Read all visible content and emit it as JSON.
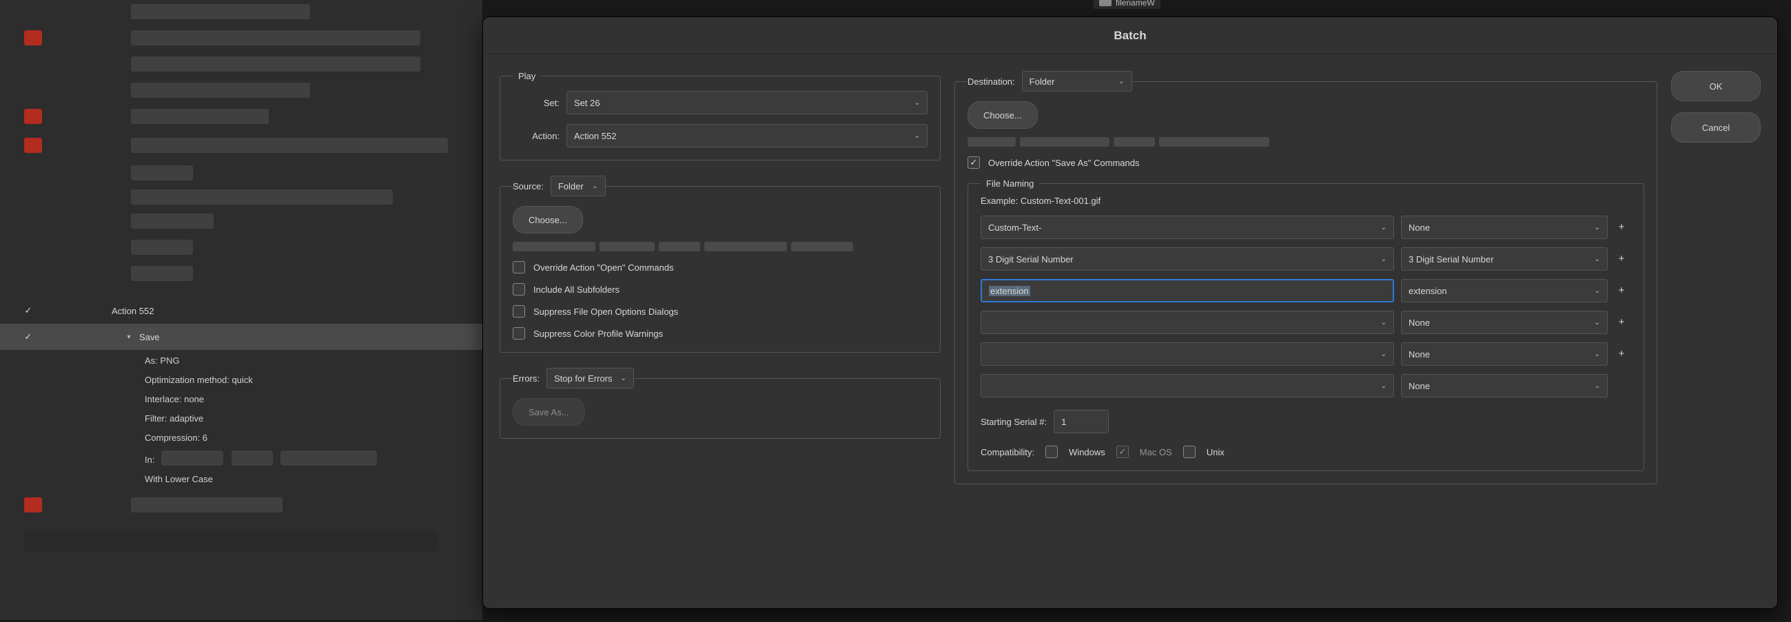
{
  "top_tab": {
    "label": "filenameW"
  },
  "actions_panel": {
    "action_row": {
      "label": "Action 552"
    },
    "save_row": {
      "label": "Save"
    },
    "details": {
      "as": "As: PNG",
      "opt": "Optimization method: quick",
      "interlace": "Interlace: none",
      "filter": "Filter: adaptive",
      "compression": "Compression: 6",
      "in": "In:",
      "withlower": "With Lower Case"
    }
  },
  "dialog": {
    "title": "Batch",
    "ok": "OK",
    "cancel": "Cancel",
    "play": {
      "legend": "Play",
      "set_label": "Set:",
      "set_value": "Set 26",
      "action_label": "Action:",
      "action_value": "Action 552"
    },
    "source": {
      "label": "Source:",
      "value": "Folder",
      "choose": "Choose...",
      "override_open": "Override Action \"Open\" Commands",
      "include_sub": "Include All Subfolders",
      "suppress_open": "Suppress File Open Options Dialogs",
      "suppress_color": "Suppress Color Profile Warnings"
    },
    "errors": {
      "label": "Errors:",
      "value": "Stop for Errors",
      "save_as": "Save As..."
    },
    "destination": {
      "label": "Destination:",
      "value": "Folder",
      "choose": "Choose...",
      "override_save": "Override Action \"Save As\" Commands"
    },
    "file_naming": {
      "legend": "File Naming",
      "example_label": "Example:",
      "example_value": "Custom-Text-001.gif",
      "rows": [
        {
          "left": "Custom-Text-",
          "right": "None"
        },
        {
          "left": "3 Digit Serial Number",
          "right": "3 Digit Serial Number"
        },
        {
          "left": "extension",
          "right": "extension",
          "focused": true
        },
        {
          "left": "",
          "right": "None"
        },
        {
          "left": "",
          "right": "None"
        },
        {
          "left": "",
          "right": "None"
        }
      ],
      "starting_label": "Starting Serial #:",
      "starting_value": "1",
      "compat_label": "Compatibility:",
      "windows": "Windows",
      "macos": "Mac OS",
      "unix": "Unix"
    }
  }
}
